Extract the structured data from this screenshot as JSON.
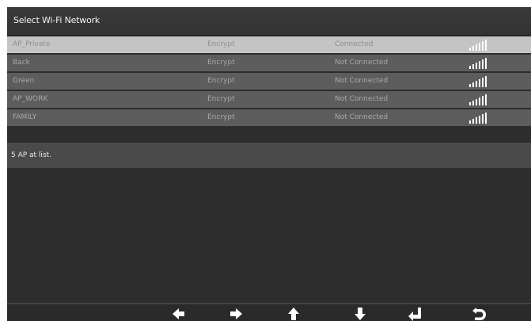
{
  "header": {
    "title": "Select Wi-Fi Network"
  },
  "networks": [
    {
      "name": "AP_Private",
      "encryption": "Encrypt",
      "status": "Connected",
      "selected": true
    },
    {
      "name": "Back",
      "encryption": "Encrypt",
      "status": "Not Connected",
      "selected": false
    },
    {
      "name": "Green",
      "encryption": "Encrypt",
      "status": "Not Connected",
      "selected": false
    },
    {
      "name": "AP_WORK",
      "encryption": "Encrypt",
      "status": "Not Connected",
      "selected": false
    },
    {
      "name": "FAMILY",
      "encryption": "Encrypt",
      "status": "Not Connected",
      "selected": false
    }
  ],
  "status_bar": {
    "text": "5 AP at list."
  },
  "nav_buttons": [
    {
      "name": "left-arrow-icon"
    },
    {
      "name": "right-arrow-icon"
    },
    {
      "name": "up-arrow-icon"
    },
    {
      "name": "down-arrow-icon"
    },
    {
      "name": "enter-icon"
    },
    {
      "name": "back-icon"
    }
  ],
  "colors": {
    "background": "#2d2d2d",
    "row": "#5d5d5d",
    "row_selected": "#c4c4c4",
    "status_bar": "#4a4a4a",
    "icon": "#ffffff"
  }
}
